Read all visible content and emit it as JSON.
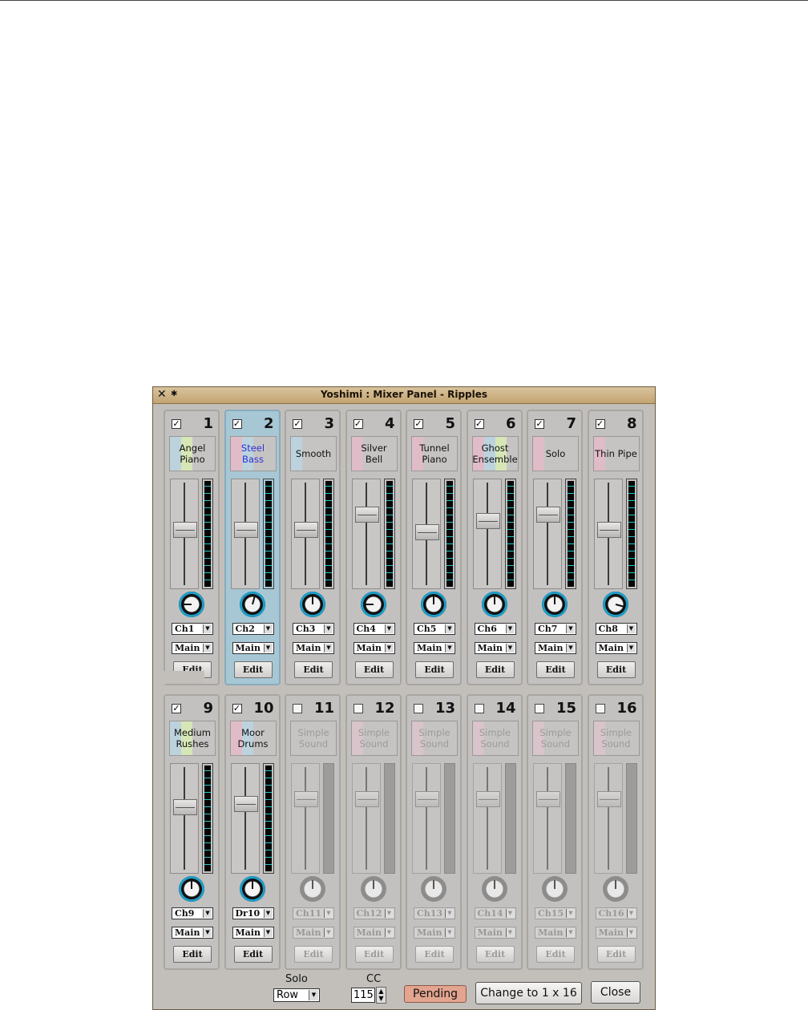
{
  "window": {
    "title": "Yoshimi : Mixer Panel - Ripples"
  },
  "strips": [
    {
      "number": "1",
      "name": "Angel Piano",
      "enabled": true,
      "channel": "Ch1",
      "output": "Main",
      "edit_label": "Edit",
      "bands": [
        "#bcd3de",
        "#d7e6b6"
      ],
      "fader_level": 0.55,
      "pan": -0.6,
      "dimmed": false
    },
    {
      "number": "2",
      "name": "Steel Bass",
      "enabled": true,
      "channel": "Ch2",
      "output": "Main",
      "edit_label": "Edit",
      "bands": [
        "#e0bcc8",
        "#bcd3de"
      ],
      "fader_level": 0.55,
      "pan": 0.1,
      "dimmed": false,
      "selected": true
    },
    {
      "number": "3",
      "name": "Smooth",
      "enabled": true,
      "channel": "Ch3",
      "output": "Main",
      "edit_label": "Edit",
      "bands": [
        "#bcd3de"
      ],
      "fader_level": 0.55,
      "pan": 0.0,
      "dimmed": false
    },
    {
      "number": "4",
      "name": "Silver Bell",
      "enabled": true,
      "channel": "Ch4",
      "output": "Main",
      "edit_label": "Edit",
      "bands": [
        "#e0bcc8"
      ],
      "fader_level": 0.72,
      "pan": -0.6,
      "dimmed": false
    },
    {
      "number": "5",
      "name": "Tunnel Piano",
      "enabled": true,
      "channel": "Ch5",
      "output": "Main",
      "edit_label": "Edit",
      "bands": [
        "#e0bcc8"
      ],
      "fader_level": 0.52,
      "pan": 0.0,
      "dimmed": false
    },
    {
      "number": "6",
      "name": "Ghost Ensemble",
      "enabled": true,
      "channel": "Ch6",
      "output": "Main",
      "edit_label": "Edit",
      "bands": [
        "#e0bcc8",
        "#bcd3de",
        "#d7e6b6"
      ],
      "fader_level": 0.65,
      "pan": 0.0,
      "dimmed": false
    },
    {
      "number": "7",
      "name": "Solo",
      "enabled": true,
      "channel": "Ch7",
      "output": "Main",
      "edit_label": "Edit",
      "bands": [
        "#e0bcc8"
      ],
      "fader_level": 0.72,
      "pan": 0.0,
      "dimmed": false
    },
    {
      "number": "8",
      "name": "Thin Pipe",
      "enabled": true,
      "channel": "Ch8",
      "output": "Main",
      "edit_label": "Edit",
      "bands": [
        "#e0bcc8"
      ],
      "fader_level": 0.55,
      "pan": 0.7,
      "dimmed": false
    },
    {
      "number": "9",
      "name": "Medium Rushes",
      "enabled": true,
      "channel": "Ch9",
      "output": "Main",
      "edit_label": "Edit",
      "bands": [
        "#bcd3de",
        "#d7e6b6"
      ],
      "fader_level": 0.63,
      "pan": 0.0,
      "dimmed": false
    },
    {
      "number": "10",
      "name": "Moor Drums",
      "enabled": true,
      "channel": "Dr10",
      "output": "Main",
      "edit_label": "Edit",
      "bands": [
        "#e0bcc8",
        "#bcd3de"
      ],
      "fader_level": 0.67,
      "pan": 0.0,
      "dimmed": false
    },
    {
      "number": "11",
      "name": "Simple Sound",
      "enabled": false,
      "channel": "Ch11",
      "output": "Main",
      "edit_label": "Edit",
      "bands": [],
      "fader_level": 0.72,
      "pan": 0.0,
      "dimmed": true
    },
    {
      "number": "12",
      "name": "Simple Sound",
      "enabled": false,
      "channel": "Ch12",
      "output": "Main",
      "edit_label": "Edit",
      "bands": [
        "#d8c4ca"
      ],
      "fader_level": 0.72,
      "pan": 0.0,
      "dimmed": true
    },
    {
      "number": "13",
      "name": "Simple Sound",
      "enabled": false,
      "channel": "Ch13",
      "output": "Main",
      "edit_label": "Edit",
      "bands": [
        "#d8c4ca"
      ],
      "fader_level": 0.72,
      "pan": 0.0,
      "dimmed": true
    },
    {
      "number": "14",
      "name": "Simple Sound",
      "enabled": false,
      "channel": "Ch14",
      "output": "Main",
      "edit_label": "Edit",
      "bands": [
        "#d8c4ca"
      ],
      "fader_level": 0.72,
      "pan": 0.0,
      "dimmed": true
    },
    {
      "number": "15",
      "name": "Simple Sound",
      "enabled": false,
      "channel": "Ch15",
      "output": "Main",
      "edit_label": "Edit",
      "bands": [
        "#d8c4ca"
      ],
      "fader_level": 0.72,
      "pan": 0.0,
      "dimmed": true
    },
    {
      "number": "16",
      "name": "Simple Sound",
      "enabled": false,
      "channel": "Ch16",
      "output": "Main",
      "edit_label": "Edit",
      "bands": [
        "#d8c4ca"
      ],
      "fader_level": 0.72,
      "pan": 0.0,
      "dimmed": true
    }
  ],
  "bottom": {
    "solo_label": "Solo",
    "solo_value": "Row",
    "cc_label": "CC",
    "cc_value": "115",
    "pending_label": "Pending",
    "layout_button": "Change to 1 x 16",
    "close_button": "Close"
  },
  "colors": {
    "title_bar": "#c8aa78",
    "selected_strip": "#a7c7d5",
    "meter_tick": "#1ec8c8",
    "pending": "#e3a490"
  }
}
